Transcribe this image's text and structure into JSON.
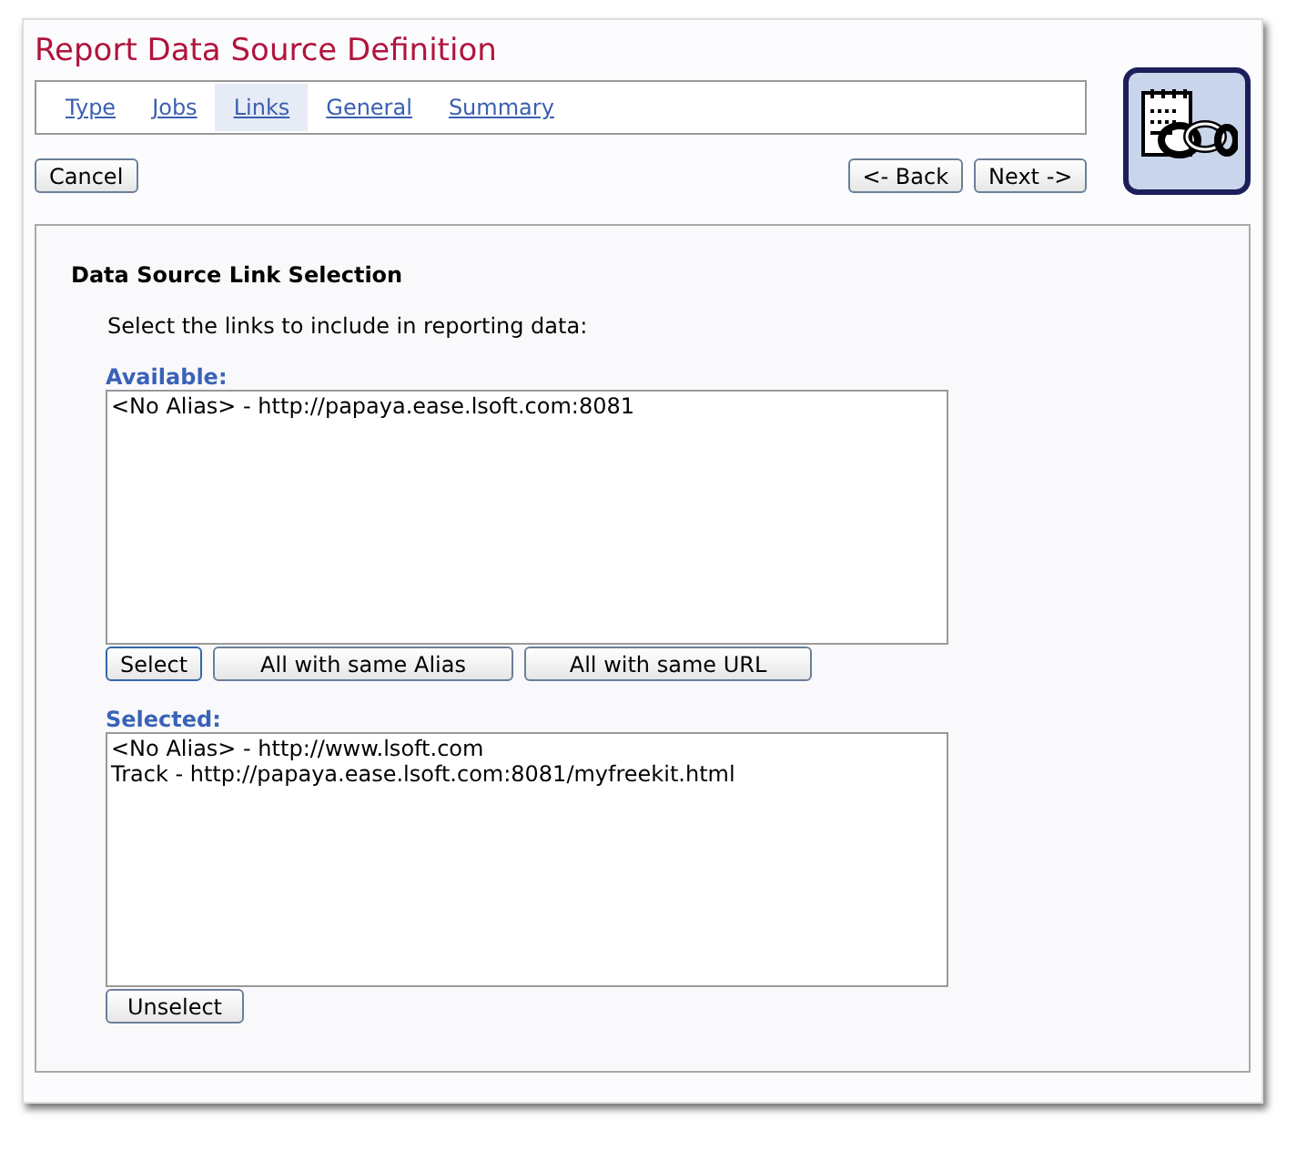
{
  "window": {
    "title": "Report Data Source Definition"
  },
  "tabs": [
    {
      "label": "Type",
      "selected": false
    },
    {
      "label": "Jobs",
      "selected": false
    },
    {
      "label": "Links",
      "selected": true
    },
    {
      "label": "General",
      "selected": false
    },
    {
      "label": "Summary",
      "selected": false
    }
  ],
  "nav_buttons": {
    "cancel": "Cancel",
    "back": "<- Back",
    "next": "Next ->"
  },
  "section": {
    "heading": "Data Source Link Selection",
    "instruction": "Select the links to include in reporting data:"
  },
  "available": {
    "label": "Available:",
    "items": [
      "<No Alias> - http://papaya.ease.lsoft.com:8081"
    ],
    "buttons": [
      "Select",
      "All with same Alias",
      "All with same URL"
    ]
  },
  "selected_list": {
    "label": "Selected:",
    "items": [
      "<No Alias> - http://www.lsoft.com",
      "Track - http://papaya.ease.lsoft.com:8081/myfreekit.html"
    ],
    "buttons": [
      "Unselect"
    ]
  }
}
